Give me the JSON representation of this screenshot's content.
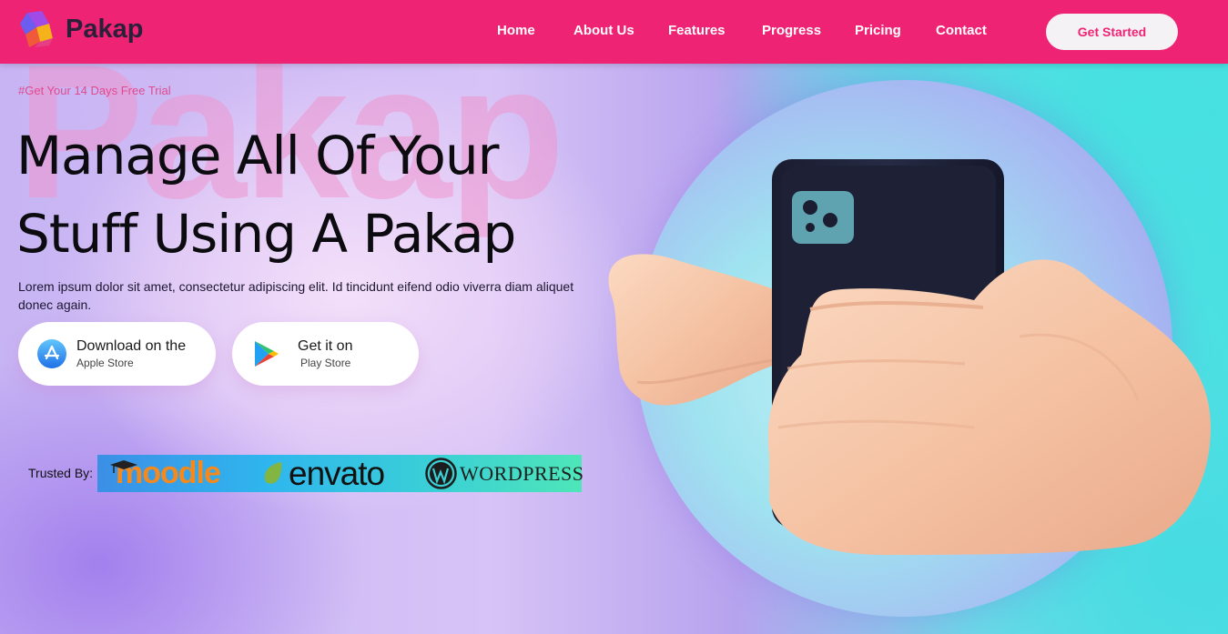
{
  "brand": {
    "name": "Pakap"
  },
  "nav": {
    "items": [
      {
        "label": "Home",
        "id": "home"
      },
      {
        "label": "About Us",
        "id": "about"
      },
      {
        "label": "Features",
        "id": "features"
      },
      {
        "label": "Progress",
        "id": "progress"
      },
      {
        "label": "Pricing",
        "id": "pricing"
      },
      {
        "label": "Contact",
        "id": "contact"
      }
    ],
    "cta_label": "Get Started"
  },
  "hero": {
    "watermark": "Pakap",
    "tagline": "#Get Your 14 Days Free Trial",
    "headline_line1": "Manage All Of Your",
    "headline_line2": "Stuff Using A Pakap",
    "description": "Lorem ipsum dolor sit amet, consectetur adipiscing elit. Id tincidunt eifend odio viverra diam aliquet donec again.",
    "apple": {
      "line1": "Download on the",
      "line2": "Apple Store"
    },
    "google": {
      "line1": "Get it on",
      "line2": "Play Store"
    }
  },
  "trusted": {
    "label": "Trusted By:",
    "brands": [
      "moodle",
      "envato",
      "WordPress"
    ]
  },
  "colors": {
    "header": "#ee2374",
    "accent": "#ee2374",
    "cta_bg": "#f5f2f5",
    "headline": "#0b0b10"
  }
}
